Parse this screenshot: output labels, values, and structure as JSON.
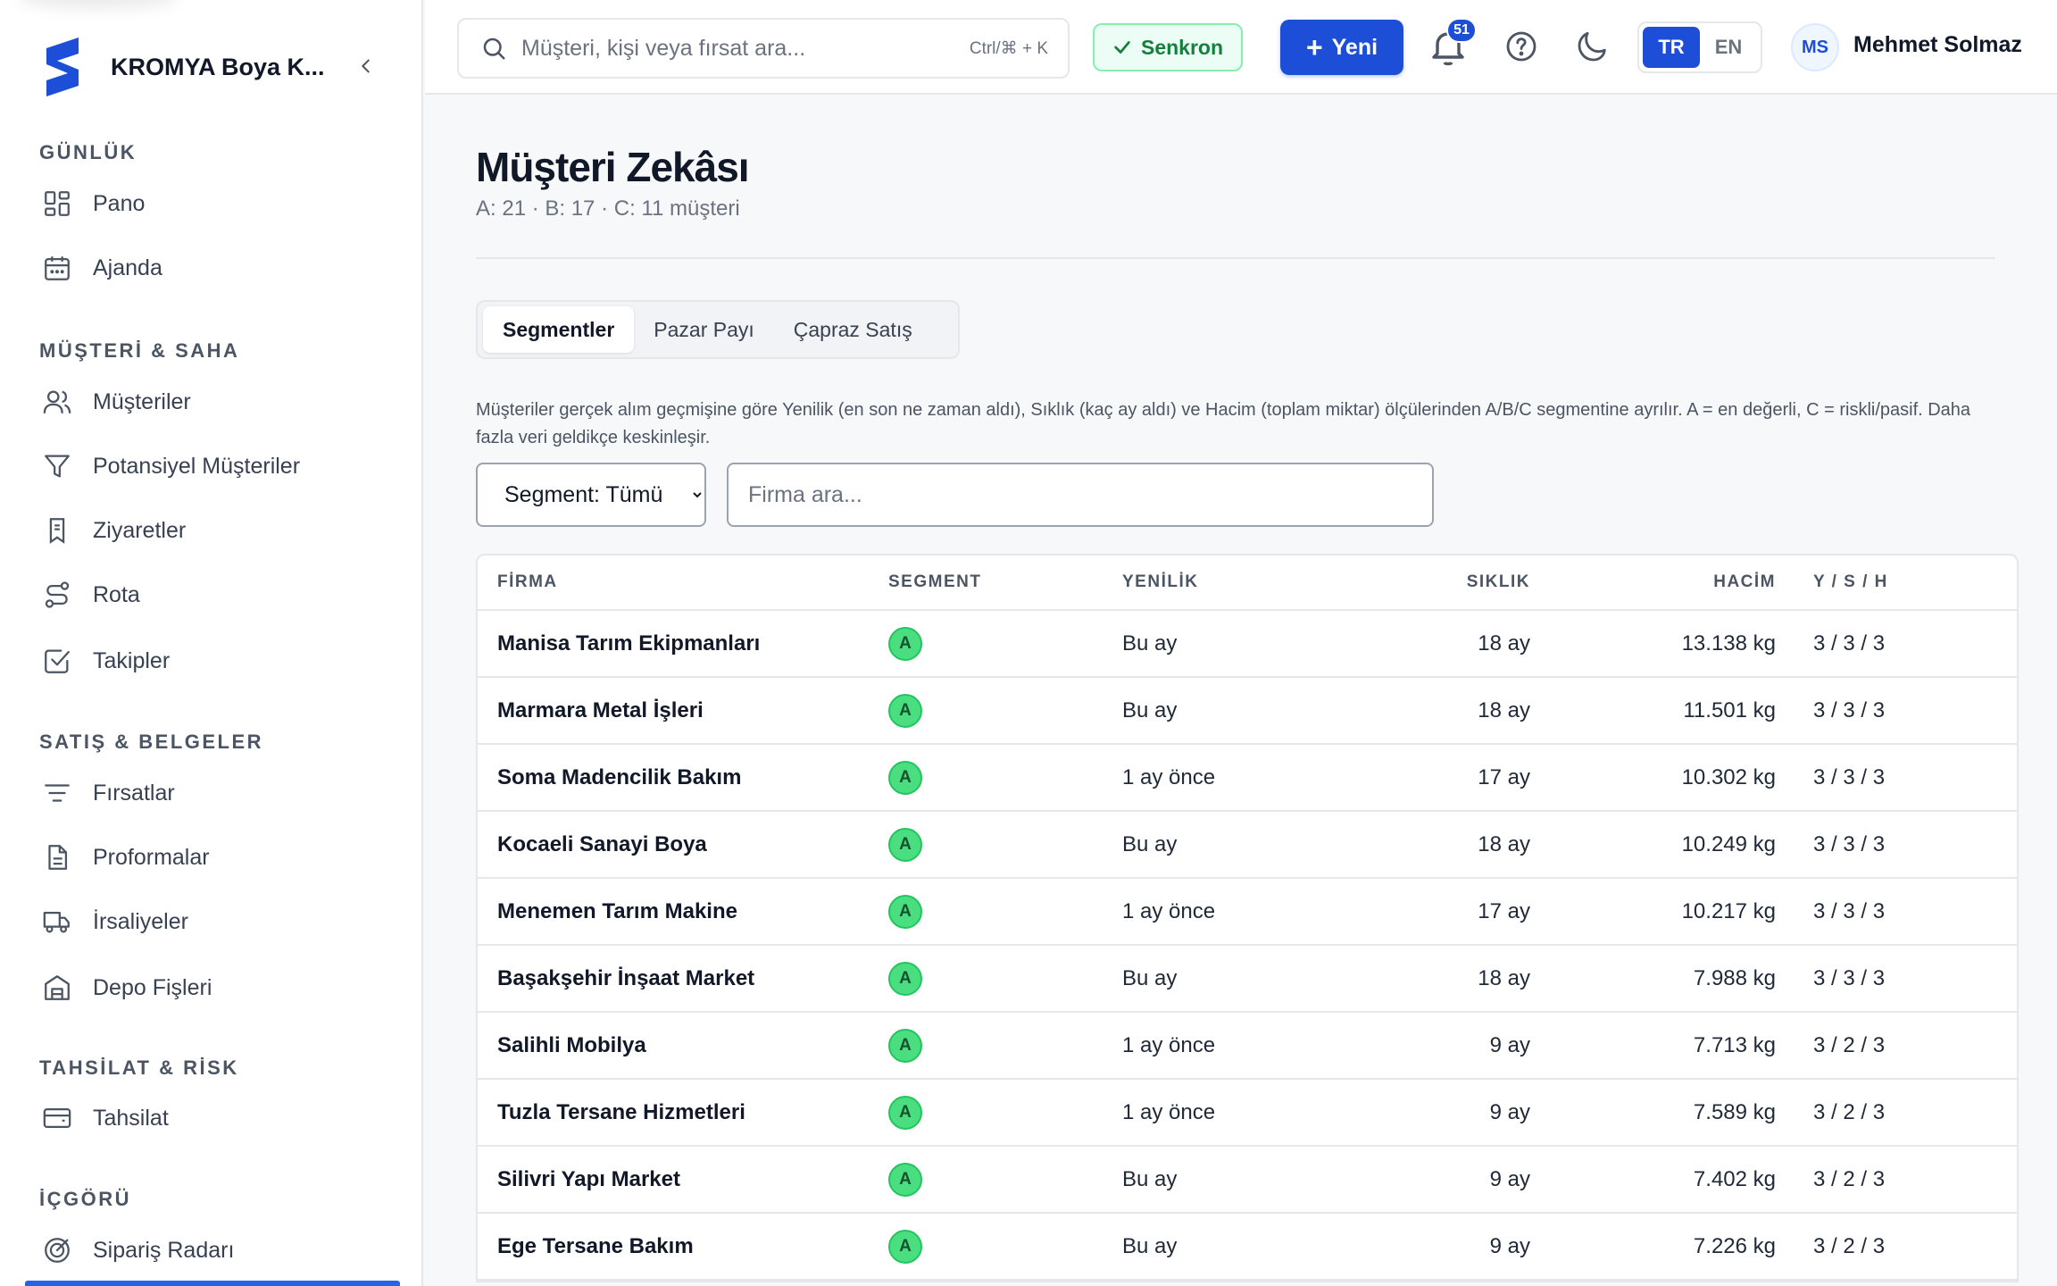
{
  "brand": {
    "name": "KROMYA Boya K..."
  },
  "sidebar": {
    "sections": [
      {
        "title": "GÜNLÜK",
        "items": [
          {
            "label": "Pano",
            "icon": "dashboard-icon"
          },
          {
            "label": "Ajanda",
            "icon": "calendar-icon"
          }
        ]
      },
      {
        "title": "MÜŞTERİ & SAHA",
        "items": [
          {
            "label": "Müşteriler",
            "icon": "users-icon"
          },
          {
            "label": "Potansiyel Müşteriler",
            "icon": "filter-icon"
          },
          {
            "label": "Ziyaretler",
            "icon": "bookmark-icon"
          },
          {
            "label": "Rota",
            "icon": "route-icon"
          },
          {
            "label": "Takipler",
            "icon": "checkbox-icon"
          }
        ]
      },
      {
        "title": "SATIŞ & BELGELER",
        "items": [
          {
            "label": "Fırsatlar",
            "icon": "funnel-lines-icon"
          },
          {
            "label": "Proformalar",
            "icon": "document-icon"
          },
          {
            "label": "İrsaliyeler",
            "icon": "truck-icon"
          },
          {
            "label": "Depo Fişleri",
            "icon": "warehouse-icon"
          }
        ]
      },
      {
        "title": "TAHSİLAT & RİSK",
        "items": [
          {
            "label": "Tahsilat",
            "icon": "wallet-icon"
          }
        ]
      },
      {
        "title": "İÇGÖRÜ",
        "items": [
          {
            "label": "Sipariş Radarı",
            "icon": "target-icon"
          }
        ]
      }
    ]
  },
  "topbar": {
    "search_placeholder": "Müşteri, kişi veya fırsat ara...",
    "shortcut": "Ctrl/⌘ + K",
    "sync_label": "Senkron",
    "new_label": "Yeni",
    "notification_count": "51",
    "lang_active": "TR",
    "lang_inactive": "EN",
    "user_initials": "MS",
    "user_name": "Mehmet Solmaz"
  },
  "page": {
    "title": "Müşteri Zekâsı",
    "subtitle": "A: 21 · B: 17 · C: 11 müşteri",
    "tabs": [
      "Segmentler",
      "Pazar Payı",
      "Çapraz Satış"
    ],
    "description": "Müşteriler gerçek alım geçmişine göre Yenilik (en son ne zaman aldı), Sıklık (kaç ay aldı) ve Hacim (toplam miktar) ölçülerinden A/B/C segmentine ayrılır. A = en değerli, C = riskli/pasif. Daha fazla veri geldikçe keskinleşir.",
    "segment_filter": "Segment: Tümü",
    "firm_search_placeholder": "Firma ara..."
  },
  "table": {
    "headers": {
      "firma": "FİRMA",
      "segment": "SEGMENT",
      "yenilik": "YENİLİK",
      "siklik": "SIKLIK",
      "hacim": "HACİM",
      "ysh": "Y / S / H"
    },
    "rows": [
      {
        "firma": "Manisa Tarım Ekipmanları",
        "segment": "A",
        "yenilik": "Bu ay",
        "siklik": "18 ay",
        "hacim": "13.138 kg",
        "ysh": "3 / 3 / 3"
      },
      {
        "firma": "Marmara Metal İşleri",
        "segment": "A",
        "yenilik": "Bu ay",
        "siklik": "18 ay",
        "hacim": "11.501 kg",
        "ysh": "3 / 3 / 3"
      },
      {
        "firma": "Soma Madencilik Bakım",
        "segment": "A",
        "yenilik": "1 ay önce",
        "siklik": "17 ay",
        "hacim": "10.302 kg",
        "ysh": "3 / 3 / 3"
      },
      {
        "firma": "Kocaeli Sanayi Boya",
        "segment": "A",
        "yenilik": "Bu ay",
        "siklik": "18 ay",
        "hacim": "10.249 kg",
        "ysh": "3 / 3 / 3"
      },
      {
        "firma": "Menemen Tarım Makine",
        "segment": "A",
        "yenilik": "1 ay önce",
        "siklik": "17 ay",
        "hacim": "10.217 kg",
        "ysh": "3 / 3 / 3"
      },
      {
        "firma": "Başakşehir İnşaat Market",
        "segment": "A",
        "yenilik": "Bu ay",
        "siklik": "18 ay",
        "hacim": "7.988 kg",
        "ysh": "3 / 3 / 3"
      },
      {
        "firma": "Salihli Mobilya",
        "segment": "A",
        "yenilik": "1 ay önce",
        "siklik": "9 ay",
        "hacim": "7.713 kg",
        "ysh": "3 / 2 / 3"
      },
      {
        "firma": "Tuzla Tersane Hizmetleri",
        "segment": "A",
        "yenilik": "1 ay önce",
        "siklik": "9 ay",
        "hacim": "7.589 kg",
        "ysh": "3 / 2 / 3"
      },
      {
        "firma": "Silivri Yapı Market",
        "segment": "A",
        "yenilik": "Bu ay",
        "siklik": "9 ay",
        "hacim": "7.402 kg",
        "ysh": "3 / 2 / 3"
      },
      {
        "firma": "Ege Tersane Bakım",
        "segment": "A",
        "yenilik": "Bu ay",
        "siklik": "9 ay",
        "hacim": "7.226 kg",
        "ysh": "3 / 2 / 3"
      }
    ]
  },
  "colors": {
    "accent": "#1d4ed8",
    "segment_a": "#4ade80",
    "sync_green": "#15803d"
  }
}
